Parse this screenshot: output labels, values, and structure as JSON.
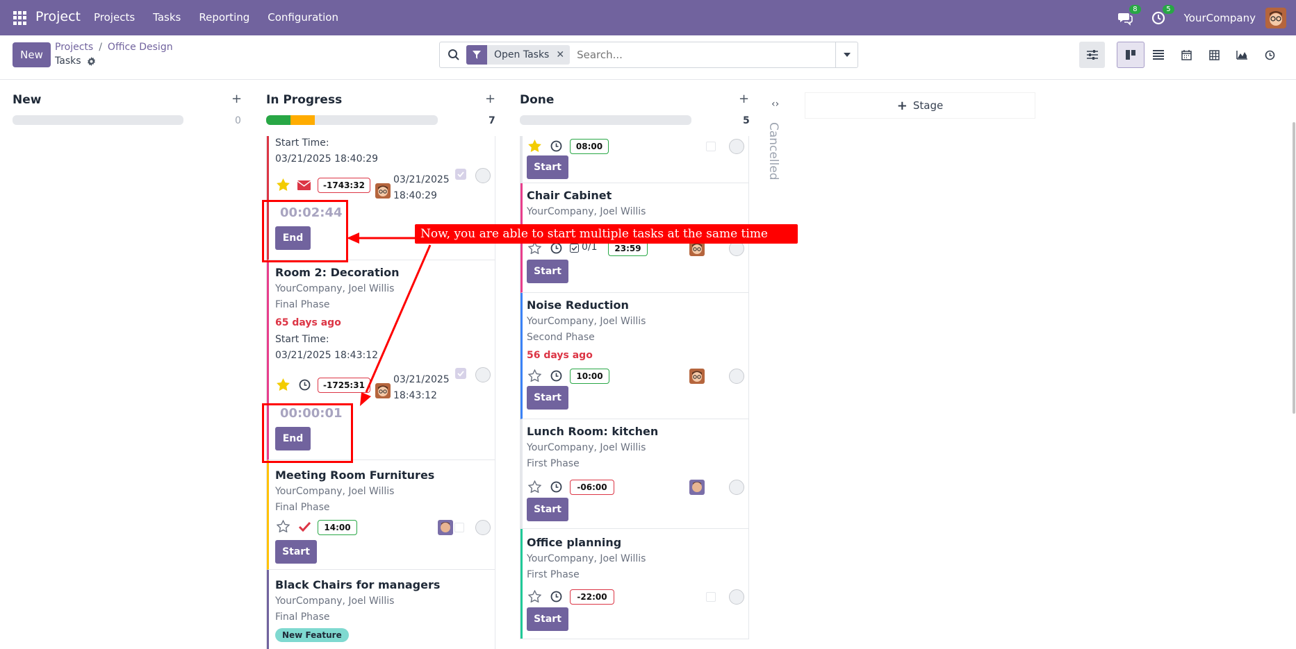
{
  "navbar": {
    "app_name": "Project",
    "menu": [
      "Projects",
      "Tasks",
      "Reporting",
      "Configuration"
    ],
    "chat_badge": "8",
    "activity_badge": "5",
    "company": "YourCompany"
  },
  "control": {
    "new_label": "New",
    "breadcrumb_root": "Projects",
    "breadcrumb_sep": "/",
    "breadcrumb_project": "Office Design",
    "breadcrumb_current": "Tasks",
    "facet_label": "Open Tasks",
    "search_placeholder": "Search..."
  },
  "columns": {
    "new": {
      "title": "New",
      "count": "0"
    },
    "in_progress": {
      "title": "In Progress",
      "count": "7",
      "progress_green": 0.14,
      "progress_orange": 0.14
    },
    "done": {
      "title": "Done",
      "count": "5"
    },
    "cancelled": {
      "title": "Cancelled"
    },
    "add_stage_label": "Stage"
  },
  "in_progress_cards": {
    "card1": {
      "start_label": "Start Time:",
      "start_time": "03/21/2025 18:40:29",
      "time": "-1743:32",
      "date1": "03/21/2025",
      "date2": "18:40:29",
      "timer": "00:02:44",
      "button": "End"
    },
    "card2": {
      "title": "Room 2: Decoration",
      "company": "YourCompany, Joel Willis",
      "phase": "Final Phase",
      "ago": "65 days ago",
      "start_label": "Start Time:",
      "start_time": "03/21/2025 18:43:12",
      "time": "-1725:31",
      "date1": "03/21/2025",
      "date2": "18:43:12",
      "timer": "00:00:01",
      "button": "End"
    },
    "card3": {
      "title": "Meeting Room Furnitures",
      "company": "YourCompany, Joel Willis",
      "phase": "Final Phase",
      "time": "14:00",
      "button": "Start"
    },
    "card4": {
      "title": "Black Chairs for managers",
      "company": "YourCompany, Joel Willis",
      "phase": "Final Phase",
      "tag": "New Feature"
    }
  },
  "done_cards": {
    "card0": {
      "time": "08:00",
      "button": "Start"
    },
    "card1": {
      "title": "Chair Cabinet",
      "company": "YourCompany, Joel Willis",
      "subtasks": "0/1",
      "time": "23:59",
      "button": "Start"
    },
    "card2": {
      "title": "Noise Reduction",
      "company": "YourCompany, Joel Willis",
      "phase": "Second Phase",
      "ago": "56 days ago",
      "time": "10:00",
      "button": "Start"
    },
    "card3": {
      "title": "Lunch Room: kitchen",
      "company": "YourCompany, Joel Willis",
      "phase": "First Phase",
      "time": "-06:00",
      "button": "Start"
    },
    "card4": {
      "title": "Office planning",
      "company": "YourCompany, Joel Willis",
      "phase": "First Phase",
      "time": "-22:00",
      "button": "Start"
    }
  },
  "annotation": {
    "callout": "Now, you are able to start multiple tasks at the same time"
  },
  "colors": {
    "brand": "#71639e",
    "annotation_red": "#ff0000",
    "success": "#28a745",
    "danger": "#dc3545",
    "warning": "#ffac00",
    "star": "#f3cc00"
  }
}
